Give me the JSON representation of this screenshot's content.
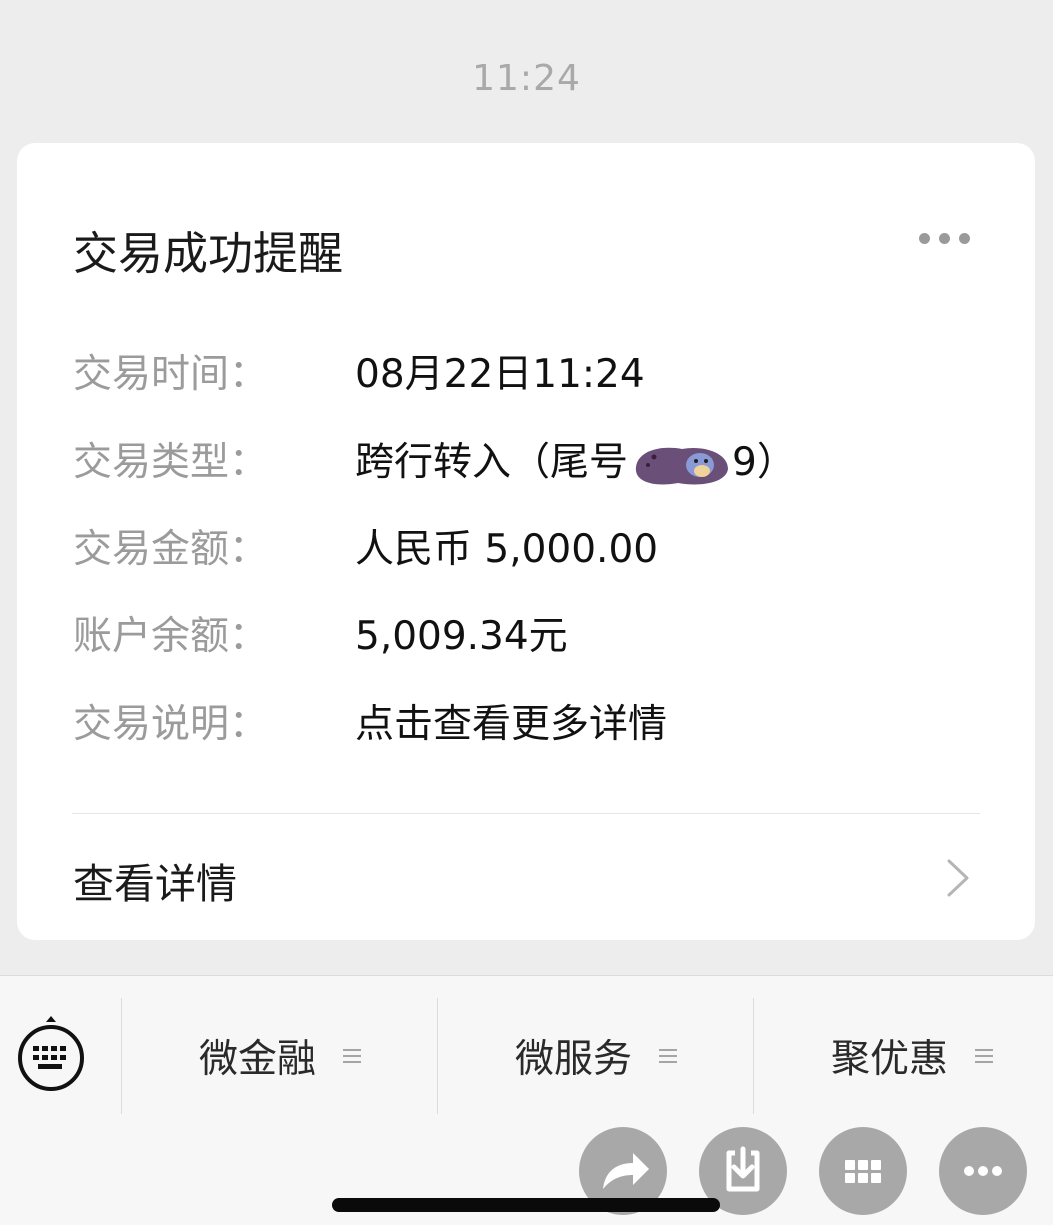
{
  "status_time": "11:24",
  "card": {
    "title": "交易成功提醒",
    "rows": [
      {
        "label": "交易时间：",
        "value": "08月22日11:24"
      },
      {
        "label": "交易类型：",
        "value_prefix": "跨行转入（尾号",
        "value_suffix": "9）"
      },
      {
        "label": "交易金额：",
        "value": "人民币 5,000.00"
      },
      {
        "label": "账户余额：",
        "value": "5,009.34元"
      },
      {
        "label": "交易说明：",
        "value": "点击查看更多详情"
      }
    ],
    "detail_link": "查看详情"
  },
  "menu": {
    "items": [
      {
        "label": "微金融"
      },
      {
        "label": "微服务"
      },
      {
        "label": "聚优惠"
      }
    ]
  },
  "colors": {
    "background": "#ededed",
    "card": "#ffffff",
    "label": "#9b9b9b",
    "value": "#111111",
    "fab": "#a8a8a8",
    "redaction": "#6a4f78"
  },
  "icons": {
    "more": "more-dots-icon",
    "chevron": "chevron-right-icon",
    "keyboard": "keyboard-icon",
    "menu": "list-lines-icon",
    "share": "share-arrow-icon",
    "download": "download-icon",
    "apps": "grid-icon",
    "more_fab": "more-horizontal-icon"
  }
}
